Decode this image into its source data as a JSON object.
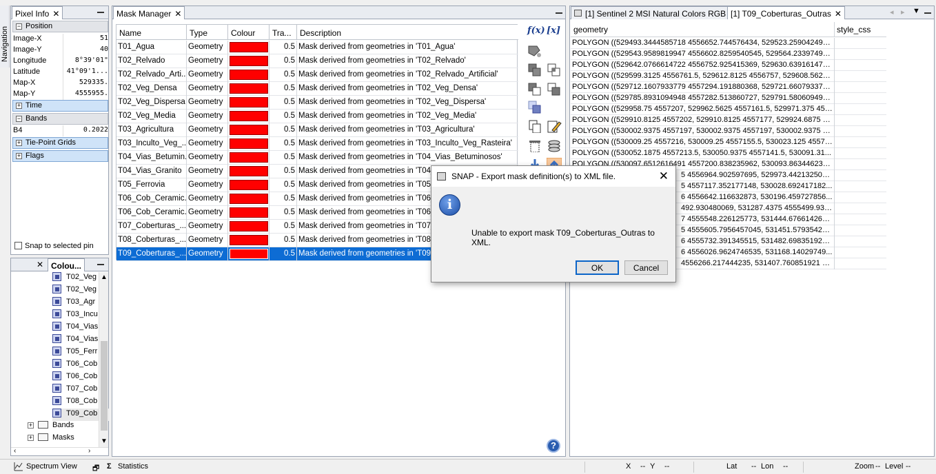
{
  "nav": {
    "label": "Navigation"
  },
  "pixel_info": {
    "title": "Pixel Info",
    "groups": {
      "position": "Position",
      "time": "Time",
      "bands": "Bands",
      "tiepoint": "Tie-Point Grids",
      "flags": "Flags"
    },
    "rows": [
      {
        "k": "Image-X",
        "v": "51"
      },
      {
        "k": "Image-Y",
        "v": "40"
      },
      {
        "k": "Longitude",
        "v": "8°39'01\""
      },
      {
        "k": "Latitude",
        "v": "41°09'1..."
      },
      {
        "k": "Map-X",
        "v": "529335."
      },
      {
        "k": "Map-Y",
        "v": "4555955."
      }
    ],
    "band_row": {
      "k": "B4",
      "v": "0.2022"
    },
    "snap_label": "Snap to selected pin"
  },
  "colour_panel": {
    "title": "Colou...",
    "items": [
      "T02_Veg",
      "T02_Veg",
      "T03_Agr",
      "T03_Incu",
      "T04_Vias",
      "T04_Vias",
      "T05_Ferr",
      "T06_Cob",
      "T06_Cob",
      "T07_Cob",
      "T08_Cob",
      "T09_Cob"
    ],
    "folders": [
      "Bands",
      "Masks"
    ]
  },
  "mask_manager": {
    "title": "Mask Manager",
    "columns": [
      "Name",
      "Type",
      "Colour",
      "Tra...",
      "Description"
    ],
    "rows": [
      {
        "name": "T01_Agua",
        "type": "Geometry",
        "tr": "0.5",
        "desc": "Mask derived from geometries in 'T01_Agua'"
      },
      {
        "name": "T02_Relvado",
        "type": "Geometry",
        "tr": "0.5",
        "desc": "Mask derived from geometries in 'T02_Relvado'"
      },
      {
        "name": "T02_Relvado_Arti...",
        "type": "Geometry",
        "tr": "0.5",
        "desc": "Mask derived from geometries in 'T02_Relvado_Artificial'"
      },
      {
        "name": "T02_Veg_Densa",
        "type": "Geometry",
        "tr": "0.5",
        "desc": "Mask derived from geometries in 'T02_Veg_Densa'"
      },
      {
        "name": "T02_Veg_Dispersa",
        "type": "Geometry",
        "tr": "0.5",
        "desc": "Mask derived from geometries in 'T02_Veg_Dispersa'"
      },
      {
        "name": "T02_Veg_Media",
        "type": "Geometry",
        "tr": "0.5",
        "desc": "Mask derived from geometries in 'T02_Veg_Media'"
      },
      {
        "name": "T03_Agricultura",
        "type": "Geometry",
        "tr": "0.5",
        "desc": "Mask derived from geometries in 'T03_Agricultura'"
      },
      {
        "name": "T03_Inculto_Veg_...",
        "type": "Geometry",
        "tr": "0.5",
        "desc": "Mask derived from geometries in 'T03_Inculto_Veg_Rasteira'"
      },
      {
        "name": "T04_Vias_Betumin...",
        "type": "Geometry",
        "tr": "0.5",
        "desc": "Mask derived from geometries in 'T04_Vias_Betuminosos'"
      },
      {
        "name": "T04_Vias_Granito",
        "type": "Geometry",
        "tr": "0.5",
        "desc": "Mask derived from geometries in 'T04_Vi"
      },
      {
        "name": "T05_Ferrovia",
        "type": "Geometry",
        "tr": "0.5",
        "desc": "Mask derived from geometries in 'T05_Fe"
      },
      {
        "name": "T06_Cob_Ceramic...",
        "type": "Geometry",
        "tr": "0.5",
        "desc": "Mask derived from geometries in 'T06_Co"
      },
      {
        "name": "T06_Cob_Ceramic...",
        "type": "Geometry",
        "tr": "0.5",
        "desc": "Mask derived from geometries in 'T06_Co"
      },
      {
        "name": "T07_Coberturas_...",
        "type": "Geometry",
        "tr": "0.5",
        "desc": "Mask derived from geometries in 'T07_Co"
      },
      {
        "name": "T08_Coberturas_...",
        "type": "Geometry",
        "tr": "0.5",
        "desc": "Mask derived from geometries in 'T08_Co"
      },
      {
        "name": "T09_Coberturas_...",
        "type": "Geometry",
        "tr": "0.5",
        "desc": "Mask derived from geometries in 'T09_Co"
      }
    ],
    "selected_index": 15,
    "swatch_color": "#ff0000",
    "selection_color": "#0d6cd4",
    "tool_fx": "f(x)",
    "tool_x": "[x]"
  },
  "vector_panel": {
    "tabs": [
      "[1] Sentinel 2 MSI Natural Colors RGB",
      "[1] T09_Coberturas_Outras"
    ],
    "columns": [
      "geometry",
      "style_css"
    ],
    "rows": [
      "POLYGON ((529493.3444585718 4556652.744576434, 529523.259042495...",
      "POLYGON ((529543.9589819947 4556602.8259540545, 529564.23397491...",
      "POLYGON ((529642.0766614722 4556752.925415369, 529630.639161472...",
      "POLYGON ((529599.3125 4556761.5, 529612.8125 4556757, 529608.5625 ...",
      "POLYGON ((529712.1607933779 4557294.191880368, 529721.660793377...",
      "POLYGON ((529785.8931094948 4557282.513860727, 529791.580609494...",
      "POLYGON ((529958.75 4557207, 529962.5625 4557161.5, 529971.375 455...",
      "POLYGON ((529910.8125 4557202, 529910.8125 4557177, 529924.6875 4...",
      "POLYGON ((530002.9375 4557197, 530002.9375 4557197, 530002.9375 4...",
      "POLYGON ((530009.25 4557216, 530009.25 4557155.5, 530023.125 45571...",
      "POLYGON ((530052.1875 4557213.5, 530050.9375 4557141.5, 530091.31...",
      "POLYGON ((530097.6512616491 4557200.838235962, 530093.863446236...",
      "5 4556964.902597695, 529973.442132508...",
      "5 4557117.352177148, 530028.692417182...",
      "6 4556642.116632873, 530196.459727856...",
      "492.930480069, 531287.4375 4555499.930...",
      "7 4555548.226125773, 531444.676614260...",
      "5 4555605.7956457045, 531451.57935429...",
      "6 4555732.391345515, 531482.698351921...",
      "6 4556026.9624746535, 531168.14029749...",
      "4556266.217444235, 531407.760851921 4..."
    ]
  },
  "dialog": {
    "title": "SNAP - Export mask definition(s) to XML file.",
    "message": "Unable to export mask T09_Coberturas_Outras to XML.",
    "ok": "OK",
    "cancel": "Cancel"
  },
  "statusbar": {
    "spectrum": "Spectrum View",
    "statistics": "Statistics",
    "x": "X",
    "x_val": "--",
    "y": "Y",
    "y_val": "--",
    "lat": "Lat",
    "lat_val": "--",
    "lon": "Lon",
    "lon_val": "--",
    "zoom": "Zoom",
    "zoom_val": "--",
    "level": "Level",
    "level_val": "--"
  }
}
